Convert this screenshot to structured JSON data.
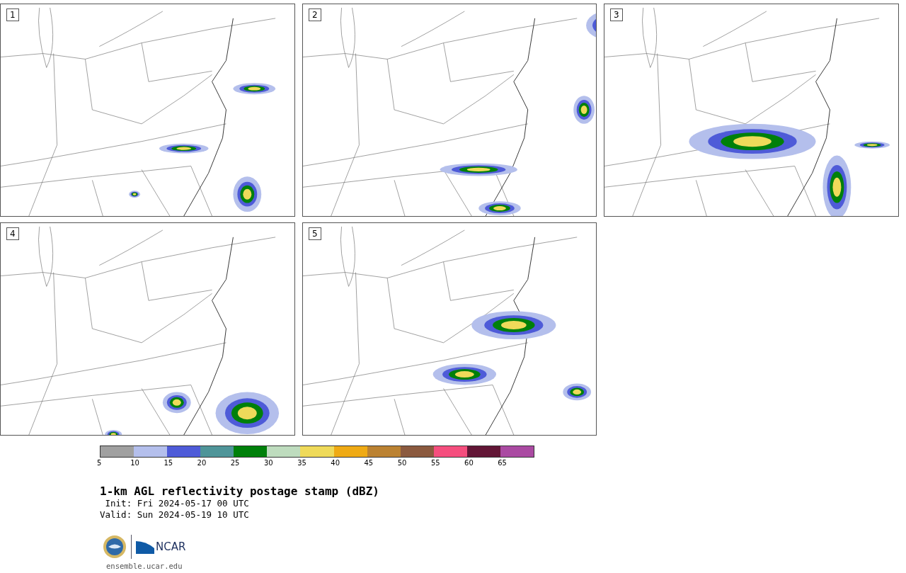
{
  "panels": [
    {
      "label": "1"
    },
    {
      "label": "2"
    },
    {
      "label": "3"
    },
    {
      "label": "4"
    },
    {
      "label": "5"
    }
  ],
  "colorbar": {
    "segments": [
      {
        "color": "#a0a0a0"
      },
      {
        "color": "#b4bfec"
      },
      {
        "color": "#4e5bd8"
      },
      {
        "color": "#4f9599"
      },
      {
        "color": "#00800a"
      },
      {
        "color": "#bedcbe"
      },
      {
        "color": "#efda5a"
      },
      {
        "color": "#efaa14"
      },
      {
        "color": "#bb8232"
      },
      {
        "color": "#8b5a3f"
      },
      {
        "color": "#f54e7e"
      },
      {
        "color": "#621636"
      },
      {
        "color": "#aa4aa2"
      }
    ],
    "ticks": [
      "5",
      "10",
      "15",
      "20",
      "25",
      "30",
      "35",
      "40",
      "45",
      "50",
      "55",
      "60",
      "65"
    ]
  },
  "title": "1-km AGL reflectivity postage stamp (dBZ)",
  "init": " Init: Fri 2024-05-17 00 UTC",
  "valid": "Valid: Sun 2024-05-19 10 UTC",
  "logo_text": "NCAR",
  "url": "ensemble.ucar.edu"
}
